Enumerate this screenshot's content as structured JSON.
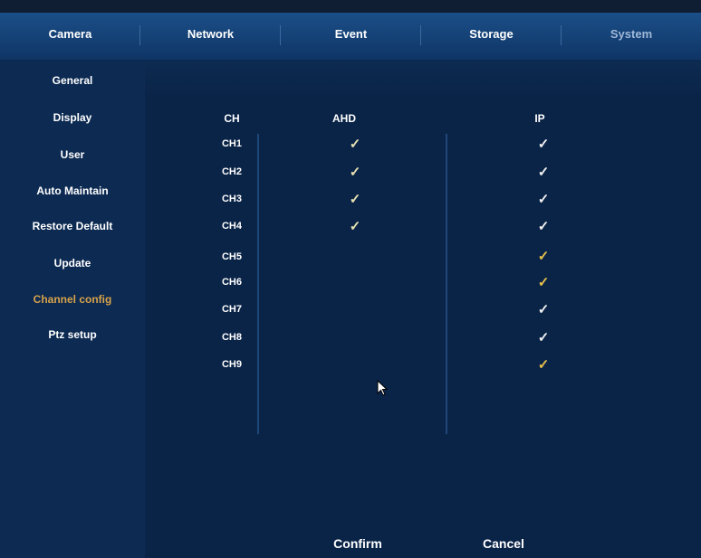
{
  "tabs": [
    {
      "label": "Camera"
    },
    {
      "label": "Network"
    },
    {
      "label": "Event"
    },
    {
      "label": "Storage"
    },
    {
      "label": "System",
      "active": true
    }
  ],
  "sidebar": {
    "items": [
      {
        "label": "General"
      },
      {
        "label": "Display"
      },
      {
        "label": "User"
      },
      {
        "label": "Auto Maintain"
      },
      {
        "label": "Restore Default"
      },
      {
        "label": "Update"
      },
      {
        "label": "Channel config",
        "selected": true
      },
      {
        "label": "Ptz setup"
      }
    ]
  },
  "channel_table": {
    "headers": {
      "ch": "CH",
      "afd": "AHD",
      "ip": "IP"
    },
    "rows": [
      {
        "ch": "CH1",
        "afd": "✓",
        "ip": "✓"
      },
      {
        "ch": "CH2",
        "afd": "✓",
        "ip": "✓"
      },
      {
        "ch": "CH3",
        "afd": "✓",
        "ip": "✓"
      },
      {
        "ch": "CH4",
        "afd": "✓",
        "ip": "✓"
      },
      {
        "ch": "CH5",
        "afd": "",
        "ip": "✓"
      },
      {
        "ch": "CH6",
        "afd": "",
        "ip": "✓"
      },
      {
        "ch": "CH7",
        "afd": "",
        "ip": "✓"
      },
      {
        "ch": "CH8",
        "afd": "",
        "ip": "✓"
      },
      {
        "ch": "CH9",
        "afd": "",
        "ip": "✓"
      }
    ]
  },
  "buttons": {
    "confirm": "Confirm",
    "cancel": "Cancel"
  },
  "colors": {
    "background": "#0a2448",
    "tabbar": "#1b4f88",
    "selected_text": "#d8a24a",
    "check_afd": "#e6e1b0",
    "check_ip": "#f0f0f0"
  }
}
